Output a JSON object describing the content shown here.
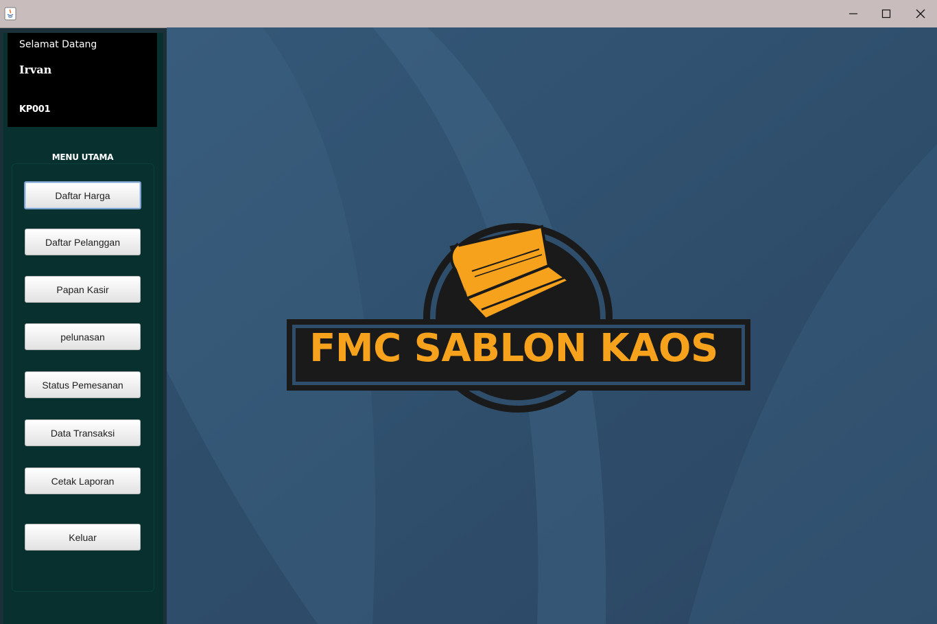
{
  "window": {
    "icon": "java-app-icon"
  },
  "sidebar": {
    "welcome_label": "Selamat Datang",
    "username": "Irvan",
    "user_code": "KP001",
    "menu_title": "MENU UTAMA",
    "menu": [
      {
        "label": "Daftar Harga",
        "icon": "none"
      },
      {
        "label": "Daftar Pelanggan",
        "icon": "none"
      },
      {
        "label": "Papan Kasir",
        "icon": "none"
      },
      {
        "label": "pelunasan",
        "icon": "none"
      },
      {
        "label": "Status Pemesanan",
        "icon": "none"
      },
      {
        "label": "Data Transaksi",
        "icon": "none"
      },
      {
        "label": "Cetak Laporan",
        "icon": "none"
      },
      {
        "label": "Keluar",
        "icon": "none"
      }
    ]
  },
  "main": {
    "logo_text": "FMC SABLON KAOS"
  },
  "colors": {
    "titlebar": "#c8bcbc",
    "sidebar": "#07302f",
    "user_panel": "#000000",
    "main_background": "#2f4e6c",
    "logo_orange": "#f6a21c",
    "logo_dark": "#1a1a1a"
  }
}
